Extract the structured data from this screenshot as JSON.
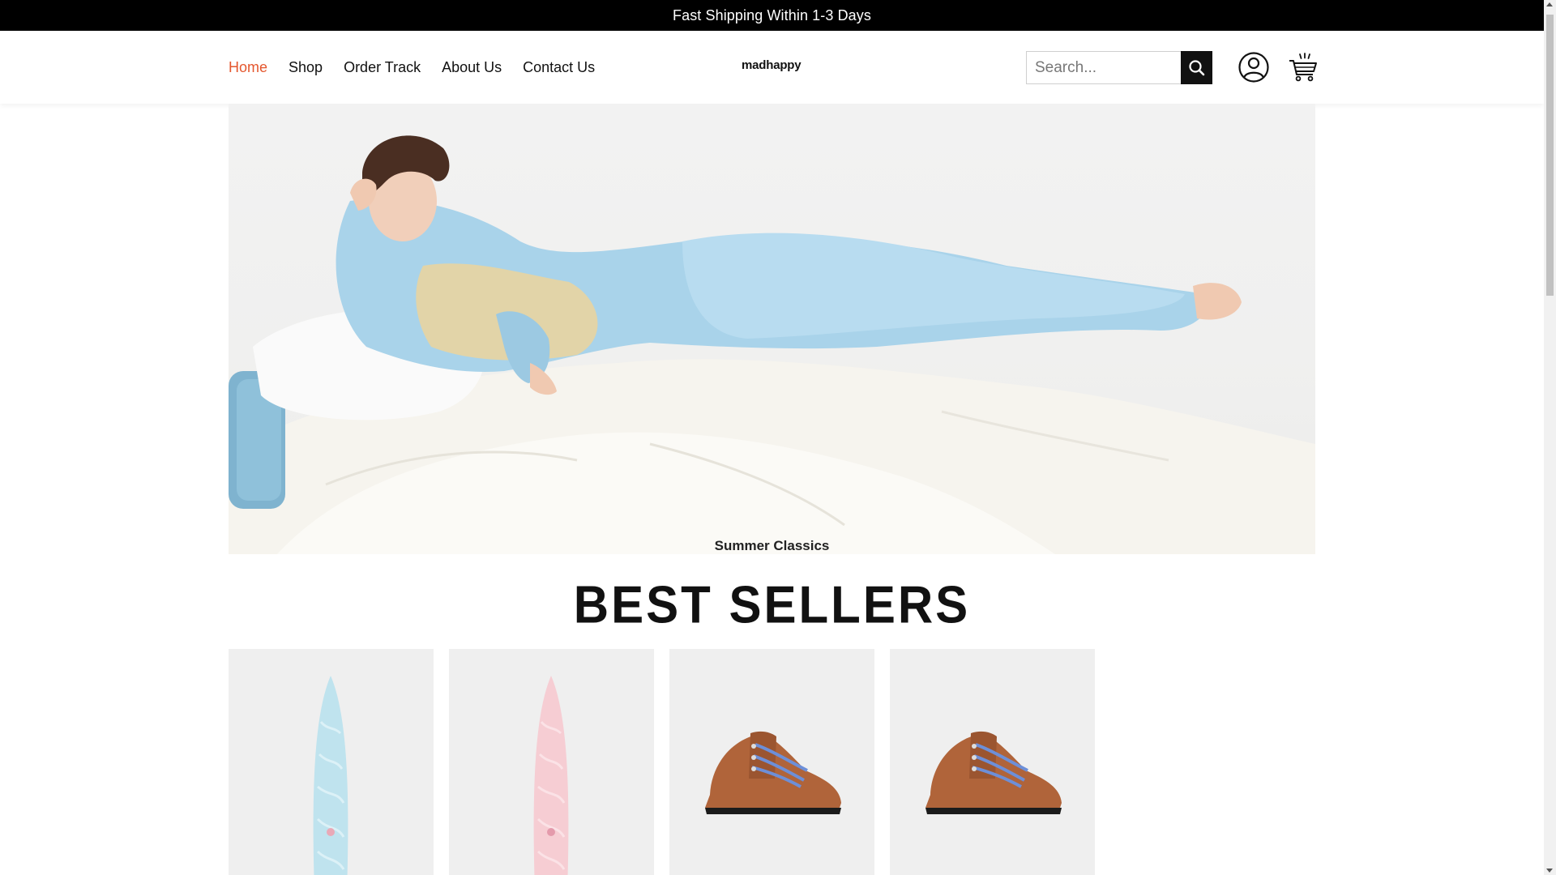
{
  "announcement": "Fast Shipping Within 1-3 Days",
  "nav": {
    "items": [
      {
        "label": "Home",
        "active": true
      },
      {
        "label": "Shop",
        "active": false
      },
      {
        "label": "Order Track",
        "active": false
      },
      {
        "label": "About Us",
        "active": false
      },
      {
        "label": "Contact Us",
        "active": false
      }
    ]
  },
  "logo": "madhappy",
  "search": {
    "placeholder": "Search...",
    "value": "",
    "icon": "search-icon"
  },
  "header_icons": {
    "user": "user-icon",
    "cart": "cart-icon"
  },
  "hero": {
    "caption": "Summer Classics"
  },
  "best_sellers": {
    "title": "BEST SELLERS",
    "products": [
      {
        "kind": "surfboard",
        "color": "#bfe3ee"
      },
      {
        "kind": "surfboard",
        "color": "#f6cdd3"
      },
      {
        "kind": "boot",
        "color": "#b0643a"
      },
      {
        "kind": "boot",
        "color": "#b0643a"
      }
    ]
  },
  "colors": {
    "accent": "#e4572e",
    "announcement_bg": "#000000"
  }
}
